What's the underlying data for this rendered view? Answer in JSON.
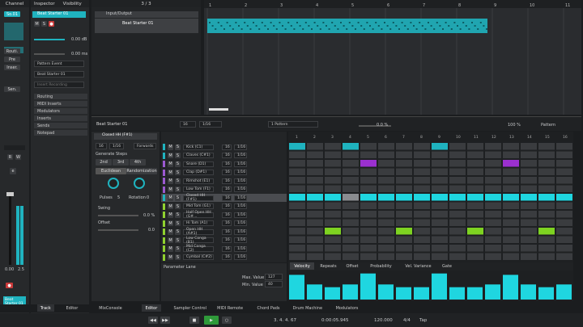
{
  "left_panel": {
    "title": "Channel",
    "channel_name": "Beat Starter 01",
    "rw": "R",
    "w": "W",
    "e": "e",
    "values": [
      "0.00",
      "2.5"
    ],
    "so_label": "So.01"
  },
  "inspector": {
    "tab_inspector": "Inspector",
    "tab_visibility": "Visibility",
    "track_name": "Beat Starter 01",
    "volume": "0.00 dB",
    "pan": "0.00 ms",
    "routing_in": "Pattern Event",
    "instrument": "Beat Starter 01",
    "insert_record": "Insert Recording",
    "sections": [
      "Routing",
      "MIDI Inserts",
      "Modulators",
      "Inserts",
      "Sends",
      "Notepad"
    ],
    "side_labels": [
      "Routi.",
      "Pre",
      "Inser.",
      "Sen."
    ]
  },
  "tracklist": {
    "count": "3 / 3",
    "folder": "Input/Output",
    "track": "Beat Starter 01"
  },
  "ruler": {
    "marks": [
      "1",
      "2",
      "3",
      "4",
      "5",
      "6",
      "7",
      "8",
      "9",
      "10",
      "11"
    ]
  },
  "editor": {
    "name": "Beat Starter 01",
    "quant_num": "16",
    "quant": "1/16",
    "pattern": "1 Pattern",
    "swing_val": "0.0 %",
    "zoom": "100 %",
    "pattern_menu": "Pattern"
  },
  "steps": {
    "title": "Generate Steps",
    "step_count": "16",
    "step_res": "1/16",
    "pattern_mode": "Forwards",
    "buttons": [
      "2nd",
      "3rd",
      "4th"
    ],
    "modes": [
      "Euclidean",
      "Randomization"
    ],
    "pulses": "Pulses",
    "pulses_val": "5",
    "rotation": "Rotation",
    "rotation_val": "0",
    "swing": "Swing",
    "swing_val": "0.0 %",
    "offset": "Offset",
    "offset_val": "0.0",
    "selected_pad": "Closed HH (F#1)"
  },
  "lanes": [
    {
      "name": "Kick (C1)",
      "color": "#1fb3bf"
    },
    {
      "name": "Claves (C#1)",
      "color": "#1fb3bf"
    },
    {
      "name": "Snare (D1)",
      "color": "#9b59d0"
    },
    {
      "name": "Clap (D#1)",
      "color": "#9b59d0"
    },
    {
      "name": "Rimshot (E1)",
      "color": "#9b59d0"
    },
    {
      "name": "Low Tom (F1)",
      "color": "#9b59d0"
    },
    {
      "name": "Closed HH (F#1)",
      "color": "#1fb3bf"
    },
    {
      "name": "Mid Tom (G1)",
      "color": "#8fd12f"
    },
    {
      "name": "Half Open HH (G#...",
      "color": "#8fd12f"
    },
    {
      "name": "Hi Tom (A1)",
      "color": "#8fd12f"
    },
    {
      "name": "Open HH (A#1)",
      "color": "#8fd12f"
    },
    {
      "name": "Low Conga (B1)",
      "color": "#8fd12f"
    },
    {
      "name": "Mid Conga (C2)",
      "color": "#8fd12f"
    },
    {
      "name": "Cymbal (C#2)",
      "color": "#8fd12f"
    }
  ],
  "lane_m": "M",
  "lane_s": "S",
  "lane_num": "16",
  "lane_res": "1/16",
  "grid_cols": [
    "1",
    "2",
    "3",
    "4",
    "5",
    "6",
    "7",
    "8",
    "9",
    "10",
    "11",
    "12",
    "13",
    "14",
    "15",
    "16"
  ],
  "param_tabs": [
    "Velocity",
    "Repeats",
    "Offset",
    "Probability",
    "Vel. Variance",
    "Gate"
  ],
  "param": {
    "title": "Parameter Lane",
    "max_label": "Max. Value",
    "max_val": "127",
    "min_label": "Min. Value",
    "min_val": "40"
  },
  "velocities": [
    0.9,
    0.55,
    0.45,
    0.55,
    0.95,
    0.55,
    0.45,
    0.45,
    0.95,
    0.45,
    0.45,
    0.55,
    0.9,
    0.55,
    0.45,
    0.55
  ],
  "bottom_tabs": [
    "Track",
    "Editor",
    "MixConsole",
    "Editor",
    "Sampler Control",
    "MIDI Remote",
    "Chord Pads",
    "Drum Machine",
    "Modulators"
  ],
  "transport": {
    "position": "3. 4. 4. 67",
    "time": "0:00:05.945",
    "tempo": "120.000",
    "signature": "4/4",
    "tap": "Tap"
  }
}
